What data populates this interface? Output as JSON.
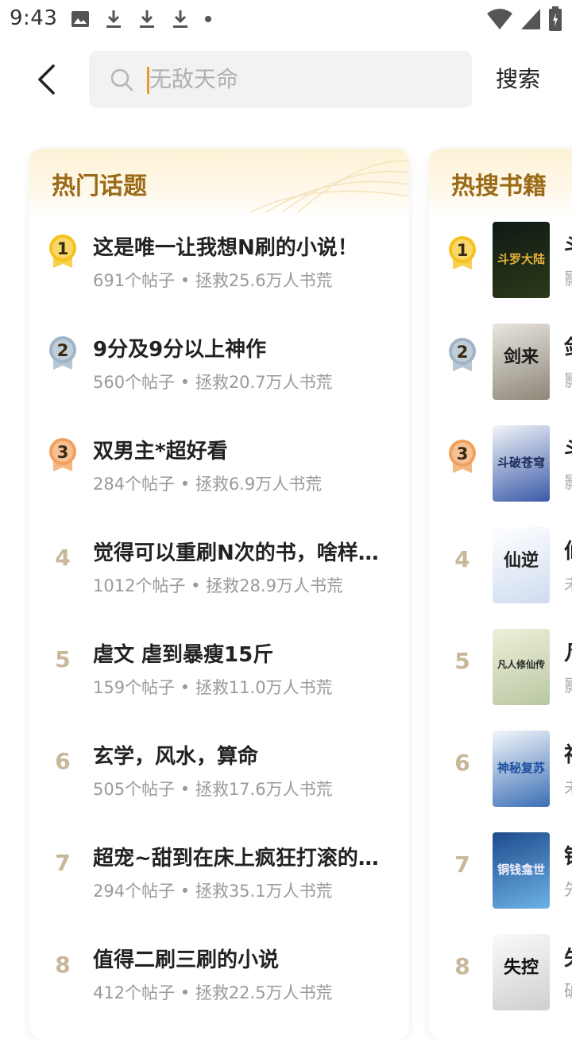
{
  "status_bar": {
    "time": "9:43",
    "icons_left": [
      "image-icon",
      "download-icon",
      "download-icon",
      "download-icon",
      "dot-icon"
    ],
    "icons_right": [
      "wifi-icon",
      "signal-icon",
      "battery-icon"
    ]
  },
  "search": {
    "placeholder": "无敌天命",
    "button_label": "搜索"
  },
  "hot_topics": {
    "title": "热门话题",
    "items": [
      {
        "rank": "1",
        "title": "这是唯一让我想N刷的小说！",
        "meta": "691个帖子 • 拯救25.6万人书荒"
      },
      {
        "rank": "2",
        "title": "9分及9分以上神作",
        "meta": "560个帖子 • 拯救20.7万人书荒"
      },
      {
        "rank": "3",
        "title": "双男主*超好看",
        "meta": "284个帖子 • 拯救6.9万人书荒"
      },
      {
        "rank": "4",
        "title": "觉得可以重刷N次的书，啥样的都…",
        "meta": "1012个帖子 • 拯救28.9万人书荒"
      },
      {
        "rank": "5",
        "title": "虐文 虐到暴瘦15斤",
        "meta": "159个帖子 • 拯救11.0万人书荒"
      },
      {
        "rank": "6",
        "title": "玄学，风水，算命",
        "meta": "505个帖子 • 拯救17.6万人书荒"
      },
      {
        "rank": "7",
        "title": "超宠~甜到在床上疯狂打滚的…",
        "meta": "294个帖子 • 拯救35.1万人书荒"
      },
      {
        "rank": "8",
        "title": "值得二刷三刷的小说",
        "meta": "412个帖子 • 拯救22.5万人书荒"
      }
    ]
  },
  "hot_books": {
    "title": "热搜书籍",
    "items": [
      {
        "rank": "1",
        "cover_text": "斗罗大陆",
        "title_partial": "斗",
        "meta_partial": "影",
        "cover_colors": [
          "#0e1a14",
          "#2d3a1a"
        ],
        "cover_text_color": "#e8b13a"
      },
      {
        "rank": "2",
        "cover_text": "剑来",
        "title_partial": "剑",
        "meta_partial": "影",
        "cover_colors": [
          "#e9e6df",
          "#8d8678"
        ],
        "cover_text_color": "#1b1b1b"
      },
      {
        "rank": "3",
        "cover_text": "斗破苍穹",
        "title_partial": "斗",
        "meta_partial": "影",
        "cover_colors": [
          "#f2f4f8",
          "#3a5aa8"
        ],
        "cover_text_color": "#1d2c5a"
      },
      {
        "rank": "4",
        "cover_text": "仙逆",
        "title_partial": "仙",
        "meta_partial": "未",
        "cover_colors": [
          "#ffffff",
          "#cfdcf0"
        ],
        "cover_text_color": "#222222"
      },
      {
        "rank": "5",
        "cover_text": "凡人修仙传",
        "title_partial": "凡",
        "meta_partial": "影",
        "cover_colors": [
          "#eef0d8",
          "#b9c7a3"
        ],
        "cover_text_color": "#2a2a2a"
      },
      {
        "rank": "6",
        "cover_text": "神秘复苏",
        "title_partial": "神",
        "meta_partial": "未",
        "cover_colors": [
          "#f4f7fb",
          "#3b6fb5"
        ],
        "cover_text_color": "#1e4fa0"
      },
      {
        "rank": "7",
        "cover_text": "铜钱龛世",
        "title_partial": "铜",
        "meta_partial": "先",
        "cover_colors": [
          "#1e4b8c",
          "#6db2e6"
        ],
        "cover_text_color": "#f4f0ff"
      },
      {
        "rank": "8",
        "cover_text": "失控",
        "title_partial": "失",
        "meta_partial": "破",
        "cover_colors": [
          "#fafafa",
          "#cfcfcf"
        ],
        "cover_text_color": "#111111"
      }
    ]
  },
  "colors": {
    "accent_title": "#9a6a16",
    "caret": "#e39b2c",
    "rank_plain": "#c9b79a",
    "medal_gold": "#f6c21b",
    "medal_silver": "#9fb4c6",
    "medal_bronze": "#f0a05c"
  }
}
